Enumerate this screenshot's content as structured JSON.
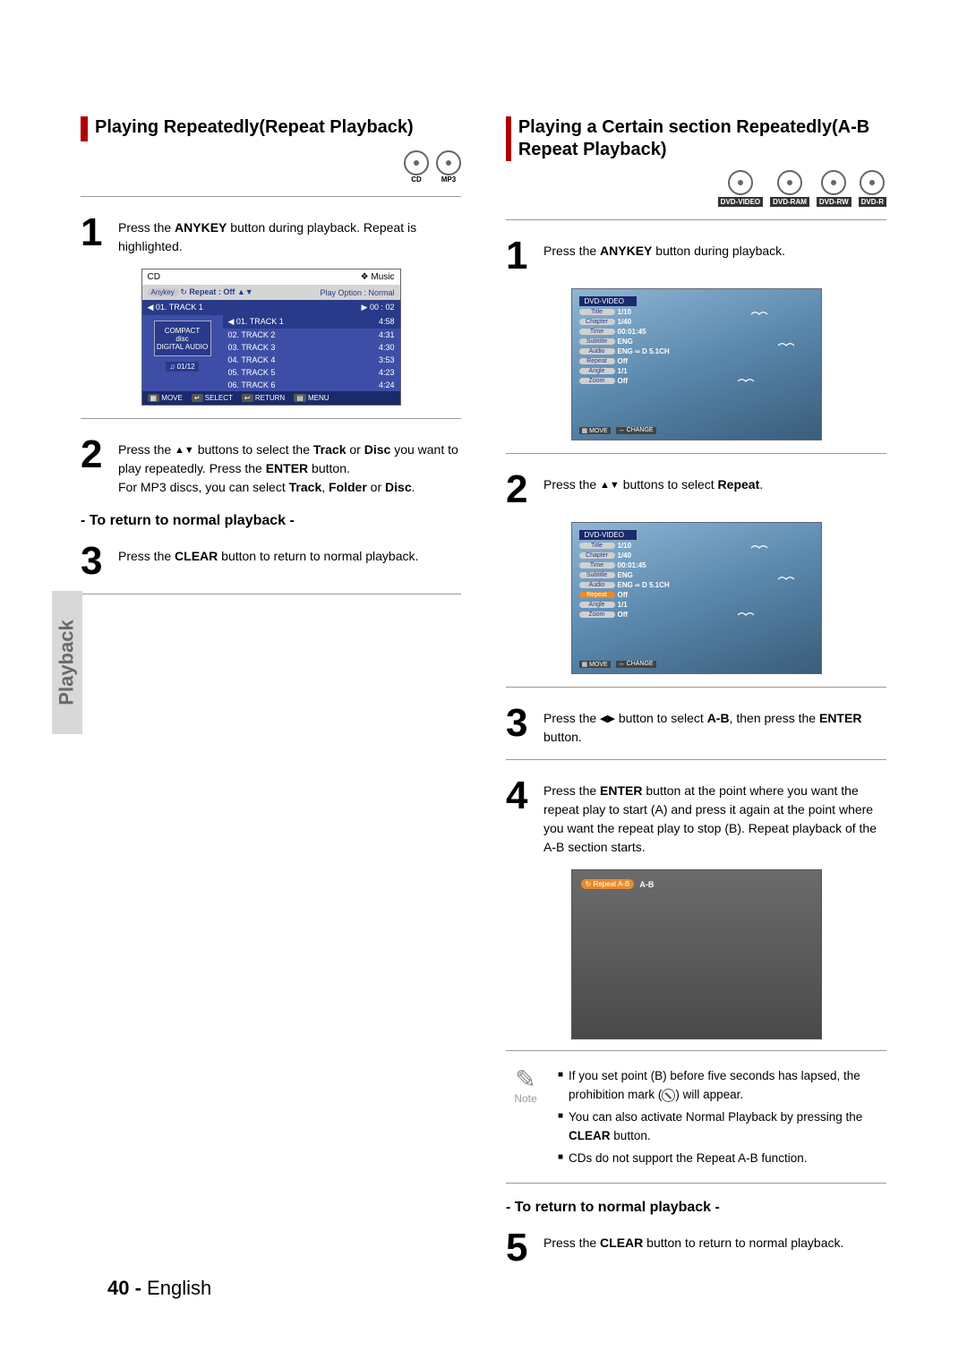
{
  "sideTab": "Playback",
  "footer": {
    "pageNum": "40 -",
    "lang": "English"
  },
  "left": {
    "title": "Playing Repeatedly(Repeat Playback)",
    "badges": [
      "CD",
      "MP3"
    ],
    "step1": {
      "num": "1",
      "pre": "Press the ",
      "bold1": "ANYKEY",
      "post": " button during playback. Repeat is highlighted."
    },
    "step2": {
      "num": "2",
      "line1_pre": "Press the ",
      "line1_post": " buttons to select the ",
      "bold_track": "Track",
      "or": " or ",
      "bold_disc": "Disc",
      "line2": " you want to play repeatedly. Press the ",
      "bold_enter": "ENTER",
      "line2_post": " button.",
      "mp3_pre": "For MP3 discs, you can select ",
      "mp3_b1": "Track",
      "mp3_mid": ", ",
      "mp3_b2": "Folder",
      "mp3_or": " or ",
      "mp3_b3": "Disc",
      "mp3_post": "."
    },
    "returnHeader": "- To return to normal playback -",
    "step3": {
      "num": "3",
      "pre": "Press the ",
      "bold": "CLEAR",
      "post": " button to return to normal playback."
    },
    "cd": {
      "title": "CD",
      "music": "❖ Music",
      "anykey": "Anykey",
      "repeat": "Repeat : Off",
      "playOption": "Play Option : Normal",
      "headerTrack": "01. TRACK 1",
      "time": "00 : 02",
      "count": "01/12",
      "tracks": [
        {
          "n": "01. TRACK 1",
          "t": "4:58"
        },
        {
          "n": "02. TRACK 2",
          "t": "4:31"
        },
        {
          "n": "03. TRACK 3",
          "t": "4:30"
        },
        {
          "n": "04. TRACK 4",
          "t": "3:53"
        },
        {
          "n": "05. TRACK 5",
          "t": "4:23"
        },
        {
          "n": "06. TRACK 6",
          "t": "4:24"
        }
      ],
      "foot": [
        "MOVE",
        "SELECT",
        "RETURN",
        "MENU"
      ]
    }
  },
  "right": {
    "title": "Playing a Certain section Repeatedly(A-B Repeat Playback)",
    "badges": [
      "DVD-VIDEO",
      "DVD-RAM",
      "DVD-RW",
      "DVD-R"
    ],
    "step1": {
      "num": "1",
      "pre": "Press the ",
      "bold": "ANYKEY",
      "post": " button during playback."
    },
    "step2": {
      "num": "2",
      "pre": "Press the ",
      "post": " buttons to select ",
      "bold": "Repeat",
      "end": "."
    },
    "step3": {
      "num": "3",
      "pre": "Press the ",
      "mid": " button to select ",
      "b1": "A-B",
      "mid2": ", then press the ",
      "b2": "ENTER",
      "post": " button."
    },
    "step4": {
      "num": "4",
      "pre": "Press the ",
      "b": "ENTER",
      "post": " button at the point where you want the repeat play to start (A) and press it again at the point where you want the repeat play to stop (B). Repeat playback of the A-B section starts."
    },
    "osd": {
      "title": "DVD-VIDEO",
      "rows": [
        {
          "lbl": "Title",
          "val": "1/10"
        },
        {
          "lbl": "Chapter",
          "val": "1/40"
        },
        {
          "lbl": "Time",
          "val": "00:01:45"
        },
        {
          "lbl": "Subtitle",
          "val": "ENG"
        },
        {
          "lbl": "Audio",
          "val": "ENG ∞ D 5.1CH"
        },
        {
          "lbl": "Repeat",
          "val": "Off"
        },
        {
          "lbl": "Angle",
          "val": "1/1"
        },
        {
          "lbl": "Zoom",
          "val": "Off"
        }
      ],
      "foot": [
        "MOVE",
        "CHANGE"
      ]
    },
    "repeatHighlightIndex": 5,
    "ab": {
      "pill": "Repeat  A-B",
      "text": "A-B"
    },
    "note": {
      "word": "Note",
      "n1_a": "If you set point (B) before five seconds has lapsed, the prohibition mark (",
      "n1_b": ") will appear.",
      "n2_a": "You can also activate Normal Playback by pressing the ",
      "n2_b": "CLEAR",
      "n2_c": " button.",
      "n3": "CDs do not support the Repeat A-B function."
    },
    "returnHeader": "- To return to normal playback -",
    "step5": {
      "num": "5",
      "pre": "Press the ",
      "bold": "CLEAR",
      "post": " button to return to normal playback."
    }
  }
}
